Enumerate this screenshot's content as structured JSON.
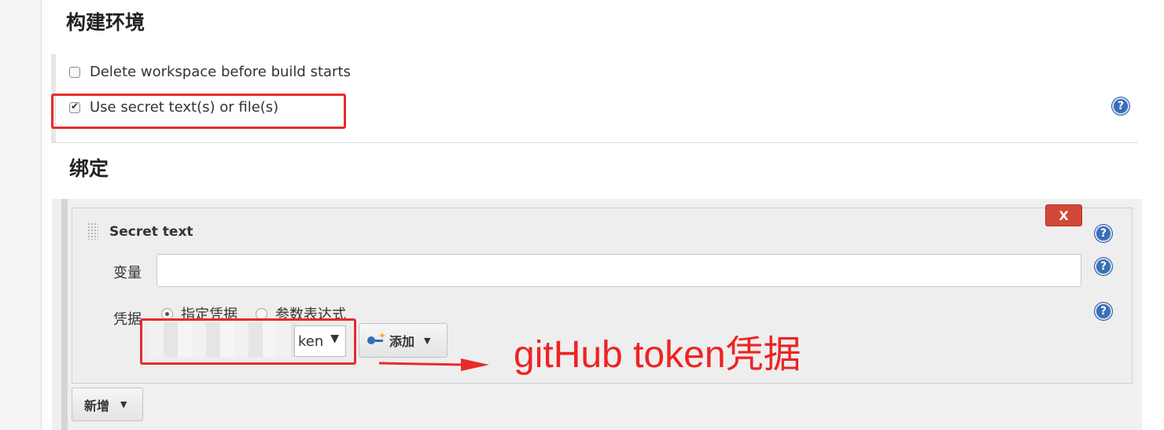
{
  "build_env": {
    "title": "构建环境",
    "checkboxes": [
      {
        "label": "Delete workspace before build starts",
        "checked": false
      },
      {
        "label": "Use secret text(s) or file(s)",
        "checked": true
      }
    ]
  },
  "bindings": {
    "title": "绑定",
    "card": {
      "title": "Secret text",
      "delete_label": "X",
      "variable_label": "变量",
      "variable_value": "",
      "credentials_label": "凭据",
      "radio_options": [
        {
          "label": "指定凭据",
          "selected": true
        },
        {
          "label": "参数表达式",
          "selected": false
        }
      ],
      "selected_credential_visible": "ken",
      "dropdown_caret": "▼",
      "add_button_label": "添加",
      "add_button_caret": "▼"
    },
    "new_button_label": "新增",
    "new_button_caret": "▼"
  },
  "help_icon_glyph": "?",
  "annotation": {
    "text": "gitHub token凭据",
    "color": "#ee2323"
  },
  "colors": {
    "help_icon": "#3b6fb6",
    "delete_button": "#d24939",
    "annotation": "#ea2a2a"
  }
}
